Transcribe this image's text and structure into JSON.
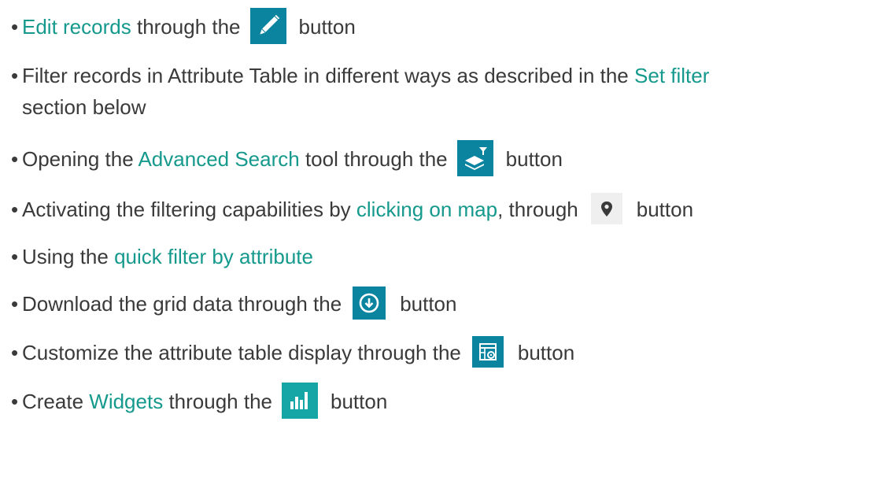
{
  "items": [
    {
      "link": "Edit records",
      "mid": "through the",
      "after": "button",
      "icon": "pencil-icon"
    },
    {
      "before": "Filter records in Attribute Table in different ways as described in the",
      "link": "Set filter",
      "cont": "section below"
    },
    {
      "before": "Opening the",
      "link": "Advanced Search",
      "mid": "tool through the",
      "after": "button",
      "icon": "advanced-search-icon"
    },
    {
      "before": "Activating the filtering capabilities by",
      "link": "clicking on map",
      "mid": ", through",
      "after": "button",
      "icon": "map-marker-icon"
    },
    {
      "before": "Using the",
      "link": "quick filter by attribute"
    },
    {
      "before": "Download the grid data through the",
      "after": "button",
      "icon": "download-icon"
    },
    {
      "before": "Customize the attribute table display through the",
      "after": "button",
      "icon": "table-settings-icon"
    },
    {
      "before": "Create",
      "link": "Widgets",
      "mid": "through the",
      "after": "button",
      "icon": "widgets-chart-icon"
    }
  ],
  "colors": {
    "text": "#3a3a3a",
    "link": "#15998d",
    "button": "#0b849f",
    "button_grey": "#efefef"
  }
}
